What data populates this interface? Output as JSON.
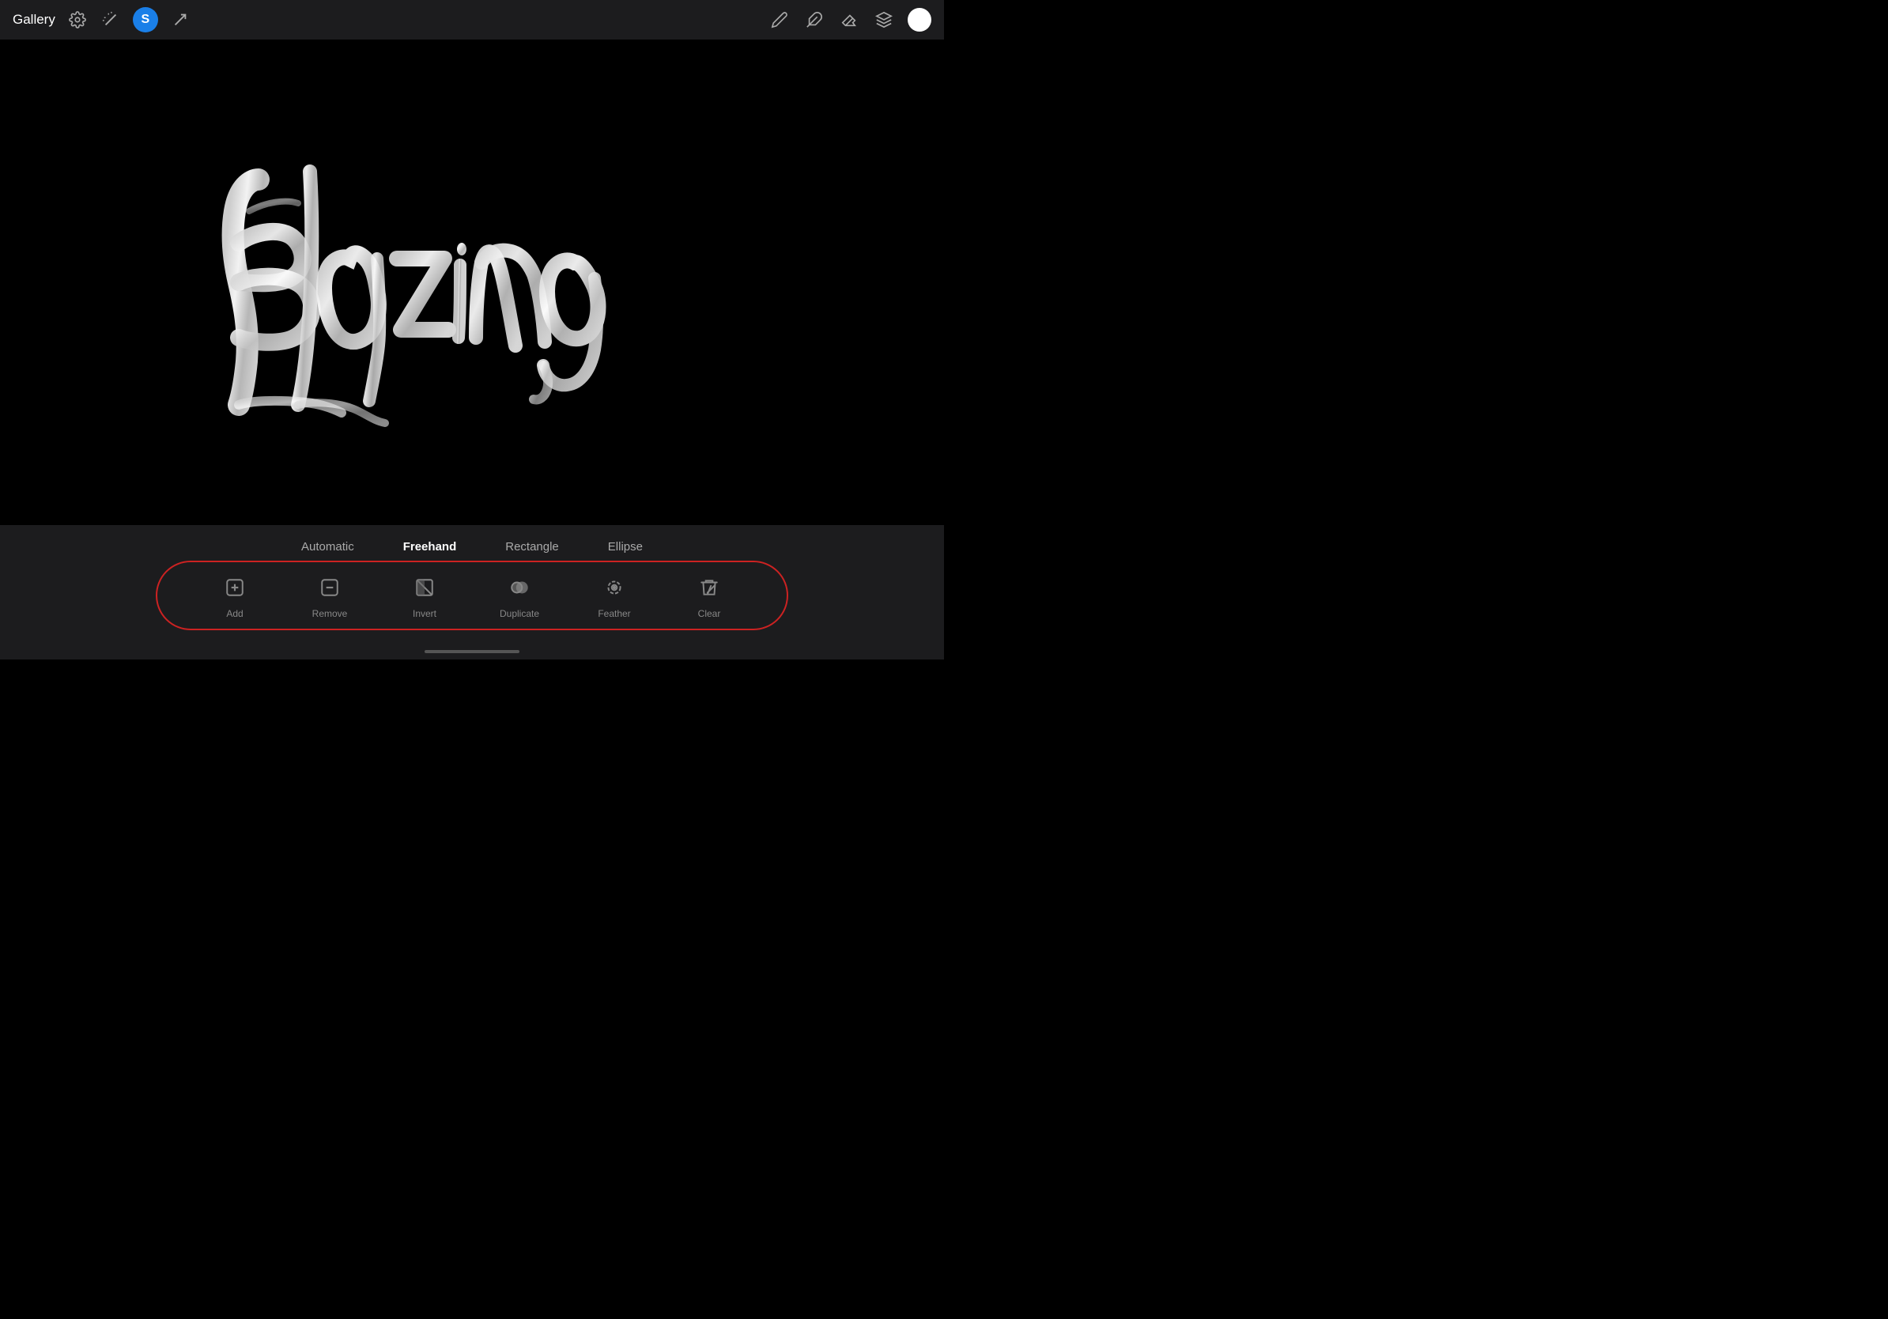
{
  "toolbar": {
    "gallery_label": "Gallery",
    "tabs": [
      "Automatic",
      "Freehand",
      "Rectangle",
      "Ellipse"
    ],
    "active_tab": "Freehand"
  },
  "tools": [
    {
      "id": "add",
      "label": "Add",
      "icon": "add"
    },
    {
      "id": "remove",
      "label": "Remove",
      "icon": "remove"
    },
    {
      "id": "invert",
      "label": "Invert",
      "icon": "invert"
    },
    {
      "id": "duplicate",
      "label": "Duplicate",
      "icon": "duplicate"
    },
    {
      "id": "feather",
      "label": "Feather",
      "icon": "feather"
    },
    {
      "id": "clear",
      "label": "Clear",
      "icon": "clear"
    }
  ],
  "canvas": {
    "text": "blazing"
  },
  "colors": {
    "bg": "#000000",
    "panel": "#1c1c1e",
    "accent": "#1a7fe8",
    "red_oval": "#cc2222",
    "active_text": "#ffffff",
    "inactive_text": "#888888"
  }
}
